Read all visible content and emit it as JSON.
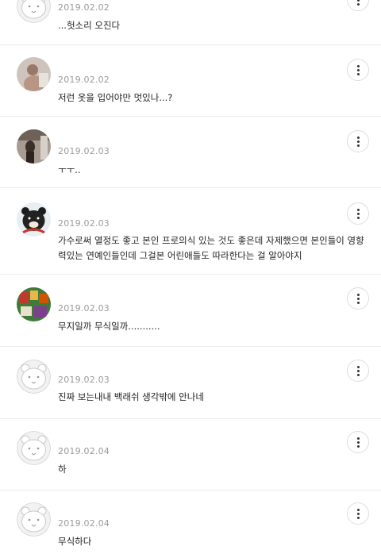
{
  "comments": [
    {
      "avatar": "default-bear-avatar",
      "date": "2019.02.02",
      "text": "...헛소리 오진다"
    },
    {
      "avatar": "user-photo-avatar",
      "date": "2019.02.02",
      "text": "저런 옷을 입어야만 멋있나...?"
    },
    {
      "avatar": "user-photo-avatar",
      "date": "2019.02.03",
      "text": "ㅜㅜ.."
    },
    {
      "avatar": "black-bear-avatar",
      "date": "2019.02.03",
      "text": "가수로써 열정도 좋고 본인 프로의식 있는 것도 좋은데 자제했으면 본인들이 영향력있는 연예인들인데 그걸본 어린애들도 따라한다는 걸 알아야지"
    },
    {
      "avatar": "user-photo-avatar",
      "date": "2019.02.03",
      "text": "무지일까 무식일까..........."
    },
    {
      "avatar": "default-bear-avatar",
      "date": "2019.02.03",
      "text": "진짜 보는내내 백래쉬 생각밖에 안나네"
    },
    {
      "avatar": "default-bear-avatar",
      "date": "2019.02.04",
      "text": "하"
    },
    {
      "avatar": "default-bear-avatar",
      "date": "2019.02.04",
      "text": "무식하다"
    }
  ],
  "more_icon": "vertical-ellipsis-icon"
}
